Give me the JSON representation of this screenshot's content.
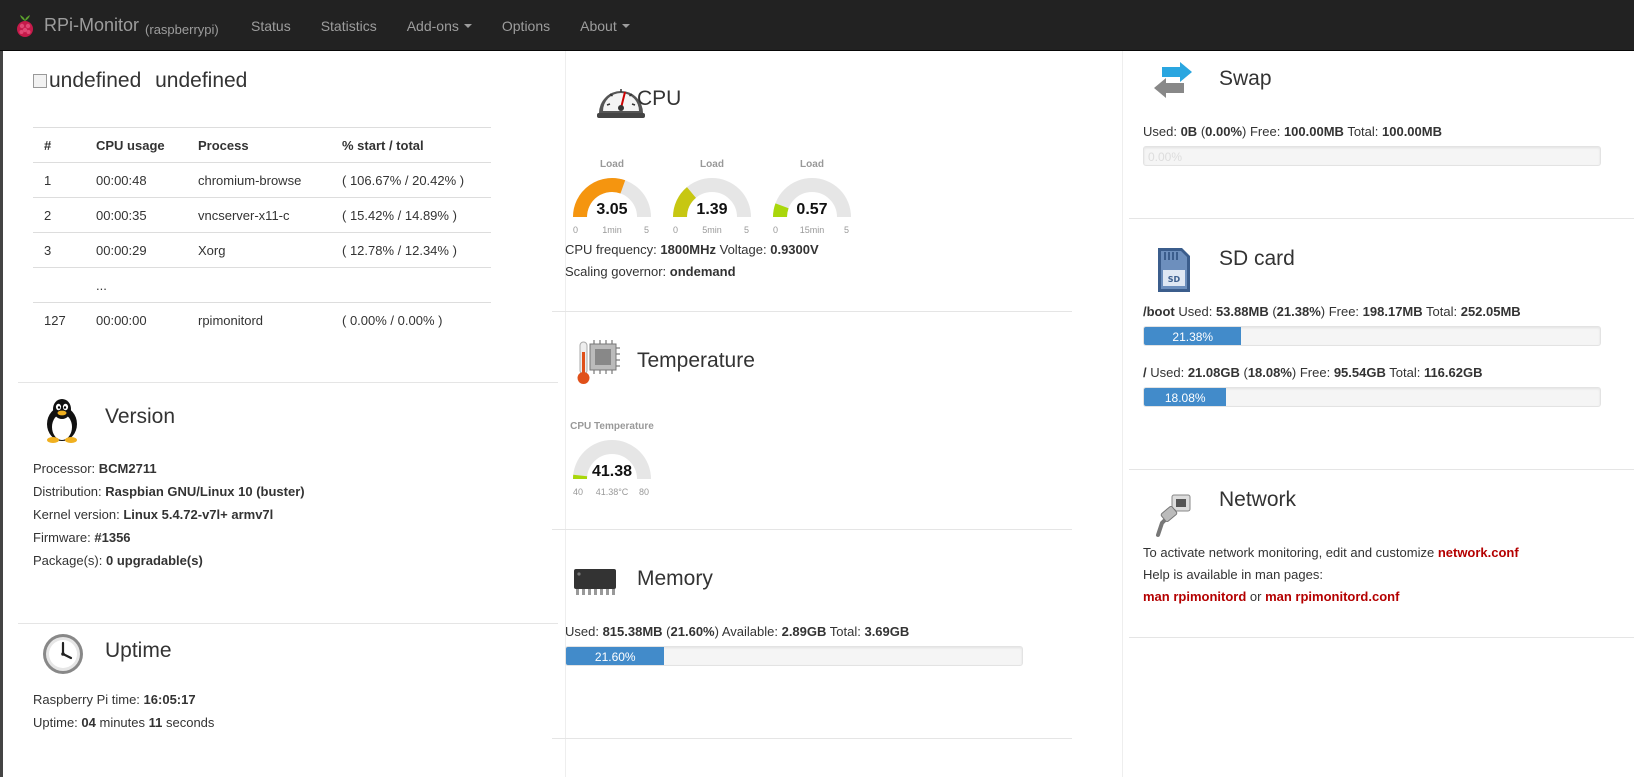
{
  "navbar": {
    "brand": "RPi-Monitor",
    "hostname": "(raspberrypi)",
    "items": [
      {
        "label": "Status",
        "dropdown": false
      },
      {
        "label": "Statistics",
        "dropdown": false
      },
      {
        "label": "Add-ons",
        "dropdown": true
      },
      {
        "label": "Options",
        "dropdown": false
      },
      {
        "label": "About",
        "dropdown": true
      }
    ]
  },
  "top_process": {
    "broken_image_alt": "undefined",
    "title": "undefined",
    "headers": [
      "#",
      "CPU usage",
      "Process",
      "% start / total"
    ],
    "rows": [
      [
        "1",
        "00:00:48",
        "chromium-browse",
        "( 106.67% / 20.42% )"
      ],
      [
        "2",
        "00:00:35",
        "vncserver-x11-c",
        "( 15.42% / 14.89% )"
      ],
      [
        "3",
        "00:00:29",
        "Xorg",
        "( 12.78% / 12.34% )"
      ],
      [
        "",
        "...",
        "",
        ""
      ],
      [
        "127",
        "00:00:00",
        "rpimonitord",
        "( 0.00% / 0.00% )"
      ]
    ]
  },
  "version": {
    "title": "Version",
    "processor_label": "Processor: ",
    "processor": "BCM2711",
    "distribution_label": "Distribution: ",
    "distribution": "Raspbian GNU/Linux 10 (buster)",
    "kernel_label": "Kernel version: ",
    "kernel": "Linux 5.4.72-v7l+ armv7l",
    "firmware_label": "Firmware: ",
    "firmware": "#1356",
    "packages_label": "Package(s): ",
    "packages": "0 upgradable(s)"
  },
  "uptime": {
    "title": "Uptime",
    "time_label": "Raspberry Pi time: ",
    "time": "16:05:17",
    "uptime_label": "Uptime: ",
    "minutes": "04",
    "minutes_word": " minutes ",
    "seconds": "11",
    "seconds_word": " seconds"
  },
  "cpu": {
    "title": "CPU",
    "gauges": [
      {
        "label": "Load",
        "value": "3.05",
        "value_num": 3.05,
        "min": "0",
        "max": "5",
        "max_num": 5,
        "sub": "1min",
        "color": "#f5950f"
      },
      {
        "label": "Load",
        "value": "1.39",
        "value_num": 1.39,
        "min": "0",
        "max": "5",
        "max_num": 5,
        "sub": "5min",
        "color": "#c7c712"
      },
      {
        "label": "Load",
        "value": "0.57",
        "value_num": 0.57,
        "min": "0",
        "max": "5",
        "max_num": 5,
        "sub": "15min",
        "color": "#a9d70b"
      }
    ],
    "freq_label": "CPU frequency: ",
    "freq": "1800MHz",
    "voltage_label": " Voltage: ",
    "voltage": "0.9300V",
    "governor_label": "Scaling governor: ",
    "governor": "ondemand"
  },
  "temperature": {
    "title": "Temperature",
    "gauge": {
      "label": "CPU Temperature",
      "value": "41.38",
      "value_num": 41.38,
      "min": "40",
      "min_num": 40,
      "max": "80",
      "max_num": 80,
      "sub": "41.38°C",
      "color": "#a9d70b"
    }
  },
  "memory": {
    "title": "Memory",
    "used_label": "Used: ",
    "used": "815.38MB",
    "paren_open": " (",
    "used_pct": "21.60%",
    "paren_close": ")",
    "available_label": " Available: ",
    "available": "2.89GB",
    "total_label": " Total: ",
    "total": "3.69GB",
    "bar_text": "21.60%",
    "bar_fraction": 0.216
  },
  "swap": {
    "title": "Swap",
    "used_label": "Used: ",
    "used": "0B",
    "paren_open": " (",
    "used_pct": "0.00%",
    "paren_close": ")",
    "free_label": " Free: ",
    "free": "100.00MB",
    "total_label": " Total: ",
    "total": "100.00MB",
    "bar_text": "0.00%",
    "bar_fraction": 0.0
  },
  "sdcard": {
    "title": "SD card",
    "boot": {
      "mount": "/boot",
      "used_label": " Used: ",
      "used": "53.88MB",
      "paren_open": " (",
      "used_pct": "21.38%",
      "paren_close": ")",
      "free_label": " Free: ",
      "free": "198.17MB",
      "total_label": " Total: ",
      "total": "252.05MB",
      "bar_text": "21.38%",
      "bar_fraction": 0.2138
    },
    "root": {
      "mount": "/",
      "used_label": " Used: ",
      "used": "21.08GB",
      "paren_open": " (",
      "used_pct": "18.08%",
      "paren_close": ")",
      "free_label": " Free: ",
      "free": "95.54GB",
      "total_label": " Total: ",
      "total": "116.62GB",
      "bar_text": "18.08%",
      "bar_fraction": 0.1808
    }
  },
  "network": {
    "title": "Network",
    "line1": "To activate network monitoring, edit and customize ",
    "line1_link": "network.conf",
    "line2": "Help is available in man pages:",
    "link_a": "man rpimonitord",
    "or": " or ",
    "link_b": "man rpimonitord.conf"
  },
  "colors": {
    "navbar": "#222222",
    "progress": "#428bca",
    "link": "#b40000"
  }
}
